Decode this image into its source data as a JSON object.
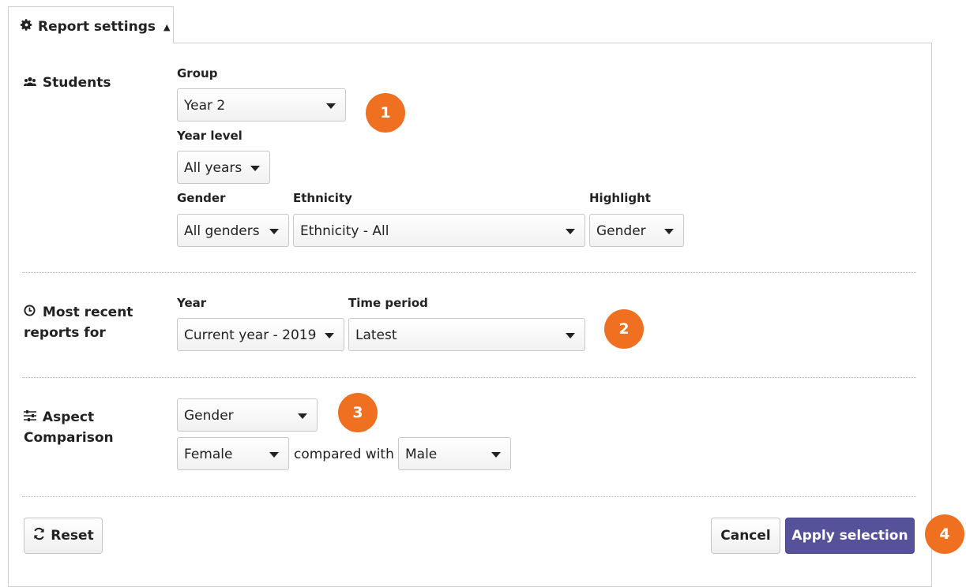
{
  "tab": {
    "label": "Report settings",
    "icon": "gear-icon",
    "caret": "▲"
  },
  "students": {
    "title": "Students",
    "icon": "users-icon",
    "group_label": "Group",
    "group_value": "Year 2",
    "year_level_label": "Year level",
    "year_level_value": "All years",
    "gender_label": "Gender",
    "gender_value": "All genders",
    "ethnicity_label": "Ethnicity",
    "ethnicity_value": "Ethnicity - All",
    "highlight_label": "Highlight",
    "highlight_value": "Gender",
    "badge": "1"
  },
  "recent": {
    "title_line1": "Most recent",
    "title_line2": "reports for",
    "icon": "clock-icon",
    "year_label": "Year",
    "year_value": "Current year - 2019",
    "period_label": "Time period",
    "period_value": "Latest",
    "badge": "2"
  },
  "aspect": {
    "title_line1": "Aspect",
    "title_line2": "Comparison",
    "icon": "sliders-icon",
    "aspect_value": "Gender",
    "left_value": "Female",
    "compared_text": "compared with",
    "right_value": "Male",
    "badge": "3"
  },
  "footer": {
    "reset_label": "Reset",
    "reset_icon": "refresh-icon",
    "cancel_label": "Cancel",
    "apply_label": "Apply selection",
    "badge": "4"
  },
  "colors": {
    "badge": "#f07022",
    "primary": "#55529a"
  }
}
